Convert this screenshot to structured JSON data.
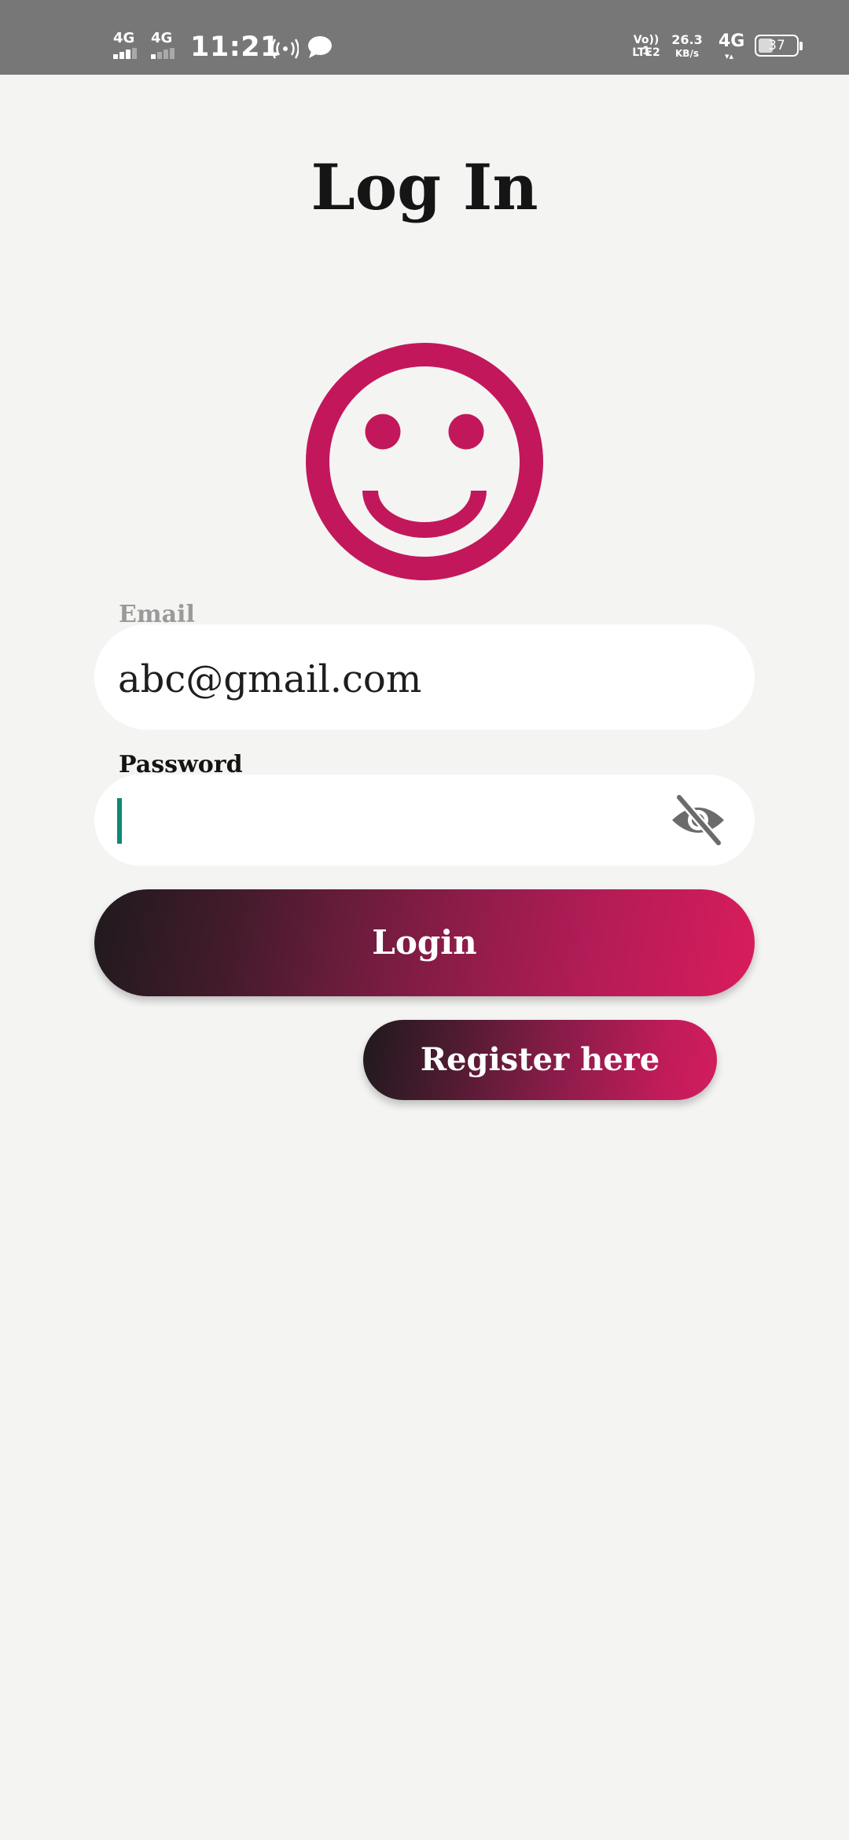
{
  "status_bar": {
    "sim1_network": "4G",
    "sim2_network": "4G",
    "time": "11:21",
    "hotspot_icon": "hotspot-icon",
    "message_icon": "chat-bubble-icon",
    "volte_top": "Vo)) 1",
    "volte_bottom": "LTE2",
    "speed_value": "26.3",
    "speed_unit": "KB/s",
    "data_network": "4G",
    "data_arrows": "▾▴",
    "battery_level": "37"
  },
  "title": "Log In",
  "avatar": {
    "icon": "smiley-face-icon",
    "color": "#c2185b"
  },
  "email": {
    "label": "Email",
    "value": "abc@gmail.com"
  },
  "password": {
    "label": "Password",
    "value": "",
    "toggle_icon": "eye-off-icon"
  },
  "buttons": {
    "login_label": "Login",
    "register_label": "Register here"
  },
  "colors": {
    "accent": "#c2185b",
    "gradient_start": "#1f1a1e",
    "gradient_end": "#d81b60",
    "caret": "#0d8a73",
    "background": "#f4f4f3",
    "status_bar": "#777777"
  }
}
